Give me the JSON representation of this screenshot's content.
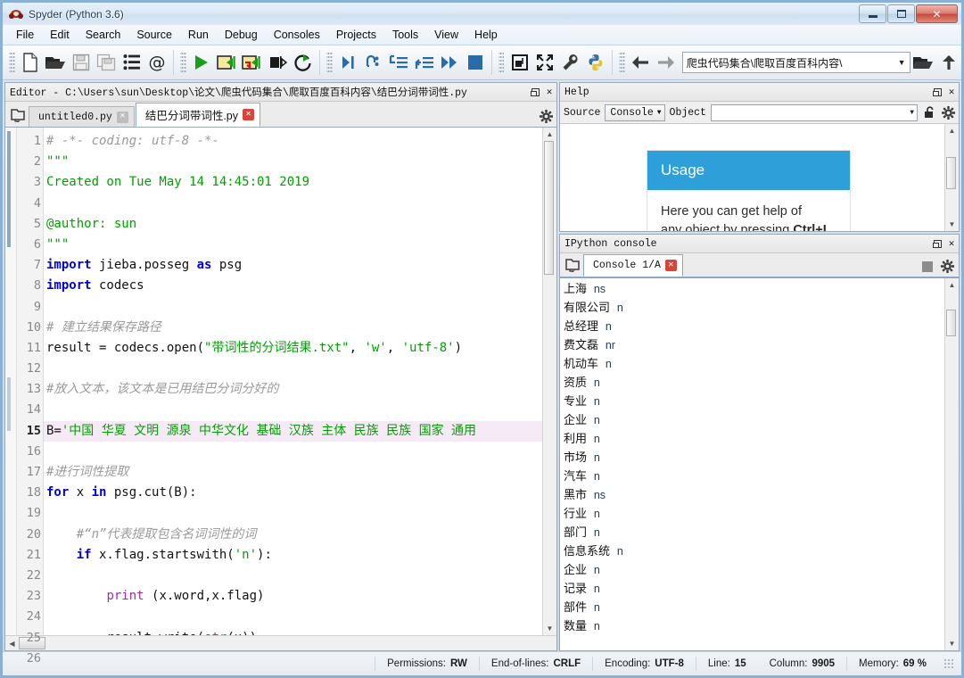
{
  "window": {
    "title": "Spyder (Python 3.6)",
    "app_icon": "spyder-icon",
    "minimize_label": "Minimize",
    "maximize_label": "Maximize",
    "close_label": "✕"
  },
  "menubar": {
    "items": [
      {
        "label": "File",
        "accel": "F"
      },
      {
        "label": "Edit",
        "accel": "E"
      },
      {
        "label": "Search",
        "accel": "S"
      },
      {
        "label": "Source",
        "accel": "c"
      },
      {
        "label": "Run",
        "accel": "R"
      },
      {
        "label": "Debug",
        "accel": "D"
      },
      {
        "label": "Consoles",
        "accel": "o"
      },
      {
        "label": "Projects",
        "accel": "P"
      },
      {
        "label": "Tools",
        "accel": "T"
      },
      {
        "label": "View",
        "accel": "V"
      },
      {
        "label": "Help",
        "accel": "H"
      }
    ]
  },
  "toolbar": {
    "buttons": [
      {
        "name": "new-file-icon",
        "tooltip": "New file"
      },
      {
        "name": "open-file-icon",
        "tooltip": "Open file"
      },
      {
        "name": "save-file-icon",
        "tooltip": "Save file"
      },
      {
        "name": "save-all-icon",
        "tooltip": "Save all"
      },
      {
        "name": "file-switcher-icon",
        "tooltip": "File switcher"
      },
      {
        "name": "find-symbol-icon",
        "tooltip": "Symbol finder"
      },
      {
        "name": "run-file-icon",
        "tooltip": "Run file"
      },
      {
        "name": "run-cell-icon",
        "tooltip": "Run current cell"
      },
      {
        "name": "run-cell-advance-icon",
        "tooltip": "Run cell and advance"
      },
      {
        "name": "run-selection-icon",
        "tooltip": "Run selection"
      },
      {
        "name": "rerun-file-icon",
        "tooltip": "Re-run last script"
      },
      {
        "name": "debug-file-icon",
        "tooltip": "Debug file"
      },
      {
        "name": "step-over-icon",
        "tooltip": "Run current line"
      },
      {
        "name": "step-into-icon",
        "tooltip": "Step into"
      },
      {
        "name": "step-return-icon",
        "tooltip": "Step return"
      },
      {
        "name": "continue-icon",
        "tooltip": "Continue execution"
      },
      {
        "name": "stop-debug-icon",
        "tooltip": "Stop debugging"
      },
      {
        "name": "maximize-pane-icon",
        "tooltip": "Maximize current pane"
      },
      {
        "name": "fullscreen-icon",
        "tooltip": "Fullscreen mode"
      },
      {
        "name": "preferences-icon",
        "tooltip": "Preferences"
      },
      {
        "name": "python-path-icon",
        "tooltip": "PYTHONPATH manager"
      },
      {
        "name": "back-icon",
        "tooltip": "Back"
      },
      {
        "name": "forward-icon",
        "tooltip": "Forward"
      },
      {
        "name": "browse-dir-icon",
        "tooltip": "Browse a working directory"
      },
      {
        "name": "parent-dir-icon",
        "tooltip": "Change to parent directory"
      }
    ],
    "path_value": "\\爬虫代码集合\\爬取百度百科内容"
  },
  "editor": {
    "pane_title": "Editor - C:\\Users\\sun\\Desktop\\论文\\爬虫代码集合\\爬取百度百科内容\\结巴分词带词性.py",
    "tabs": [
      {
        "label": "untitled0.py",
        "active": false
      },
      {
        "label": "结巴分词带词性.py",
        "active": true
      }
    ],
    "current_line": 15,
    "lines": [
      {
        "n": 1,
        "tokens": [
          {
            "t": "# -*- coding: utf-8 -*-",
            "c": "cm"
          }
        ]
      },
      {
        "n": 2,
        "tokens": [
          {
            "t": "\"\"\"",
            "c": "cs"
          }
        ]
      },
      {
        "n": 3,
        "tokens": [
          {
            "t": "Created on Tue May 14 14:45:01 2019",
            "c": "cs"
          }
        ]
      },
      {
        "n": 4,
        "tokens": []
      },
      {
        "n": 5,
        "tokens": [
          {
            "t": "@author: sun",
            "c": "cs"
          }
        ]
      },
      {
        "n": 6,
        "tokens": [
          {
            "t": "\"\"\"",
            "c": "cs"
          }
        ]
      },
      {
        "n": 7,
        "tokens": [
          {
            "t": "import",
            "c": "ck"
          },
          {
            "t": " jieba.posseg ",
            "c": "cn"
          },
          {
            "t": "as",
            "c": "ck"
          },
          {
            "t": " psg",
            "c": "cn"
          }
        ]
      },
      {
        "n": 8,
        "tokens": [
          {
            "t": "import",
            "c": "ck"
          },
          {
            "t": " codecs",
            "c": "cn"
          }
        ]
      },
      {
        "n": 9,
        "tokens": []
      },
      {
        "n": 10,
        "tokens": [
          {
            "t": "# 建立结果保存路径",
            "c": "cm"
          }
        ]
      },
      {
        "n": 11,
        "tokens": [
          {
            "t": "result = codecs.open(",
            "c": "cn"
          },
          {
            "t": "\"带词性的分词结果.txt\"",
            "c": "cs"
          },
          {
            "t": ", ",
            "c": "cn"
          },
          {
            "t": "'w'",
            "c": "cs"
          },
          {
            "t": ", ",
            "c": "cn"
          },
          {
            "t": "'utf-8'",
            "c": "cs"
          },
          {
            "t": ")",
            "c": "cn"
          }
        ]
      },
      {
        "n": 12,
        "tokens": []
      },
      {
        "n": 13,
        "tokens": [
          {
            "t": "#放入文本，该文本是已用结巴分词分好的",
            "c": "cm"
          }
        ]
      },
      {
        "n": 14,
        "tokens": []
      },
      {
        "n": 15,
        "tokens": [
          {
            "t": "B=",
            "c": "cn"
          },
          {
            "t": "'中国 华夏 文明 源泉 中华文化 基础 汉族 主体 民族 民族 国家 通用",
            "c": "cs"
          }
        ],
        "current": true
      },
      {
        "n": 16,
        "tokens": []
      },
      {
        "n": 17,
        "tokens": [
          {
            "t": "#进行词性提取",
            "c": "cm"
          }
        ]
      },
      {
        "n": 18,
        "tokens": [
          {
            "t": "for",
            "c": "ck"
          },
          {
            "t": " x ",
            "c": "cn"
          },
          {
            "t": "in",
            "c": "ck"
          },
          {
            "t": " psg.cut(B):",
            "c": "cn"
          }
        ]
      },
      {
        "n": 19,
        "tokens": []
      },
      {
        "n": 20,
        "tokens": [
          {
            "t": "    #“n”代表提取包含名词词性的词",
            "c": "cm"
          }
        ]
      },
      {
        "n": 21,
        "tokens": [
          {
            "t": "    ",
            "c": "cn"
          },
          {
            "t": "if",
            "c": "ck"
          },
          {
            "t": " x.flag.startswith(",
            "c": "cn"
          },
          {
            "t": "'n'",
            "c": "cs"
          },
          {
            "t": "):",
            "c": "cn"
          }
        ]
      },
      {
        "n": 22,
        "tokens": []
      },
      {
        "n": 23,
        "tokens": [
          {
            "t": "        ",
            "c": "cn"
          },
          {
            "t": "print",
            "c": "cb"
          },
          {
            "t": " (x.word,x.flag)",
            "c": "cn"
          }
        ]
      },
      {
        "n": 24,
        "tokens": []
      },
      {
        "n": 25,
        "tokens": [
          {
            "t": "        result.write(",
            "c": "cn"
          },
          {
            "t": "str",
            "c": "cb"
          },
          {
            "t": "(x))",
            "c": "cn"
          }
        ]
      },
      {
        "n": 26,
        "tokens": []
      }
    ]
  },
  "help": {
    "pane_title": "Help",
    "source_label": "Source",
    "source_value": "Console",
    "object_label": "Object",
    "object_value": "",
    "lock_icon": "unlock-icon",
    "options_icon": "gear-icon",
    "card_title": "Usage",
    "card_text_1": "Here you can get help of",
    "card_text_2_pre": "any object by pressing ",
    "card_text_2_bold": "Ctrl+I",
    "card_accent": "#2e9fd8"
  },
  "console": {
    "pane_title": "IPython console",
    "tab_label": "Console 1/A",
    "browse_icon": "browse-tabs-icon",
    "stop_icon": "stop-icon",
    "options_icon": "gear-icon",
    "output": [
      {
        "word": "上海",
        "flag": "ns"
      },
      {
        "word": "有限公司",
        "flag": "n"
      },
      {
        "word": "总经理",
        "flag": "n"
      },
      {
        "word": "费文磊",
        "flag": "nr"
      },
      {
        "word": "机动车",
        "flag": "n"
      },
      {
        "word": "资质",
        "flag": "n"
      },
      {
        "word": "专业",
        "flag": "n"
      },
      {
        "word": "企业",
        "flag": "n"
      },
      {
        "word": "利用",
        "flag": "n"
      },
      {
        "word": "市场",
        "flag": "n"
      },
      {
        "word": "汽车",
        "flag": "n"
      },
      {
        "word": "黑市",
        "flag": "ns"
      },
      {
        "word": "行业",
        "flag": "n"
      },
      {
        "word": "部门",
        "flag": "n"
      },
      {
        "word": "信息系统",
        "flag": "n"
      },
      {
        "word": "企业",
        "flag": "n"
      },
      {
        "word": "记录",
        "flag": "n"
      },
      {
        "word": "部件",
        "flag": "n"
      },
      {
        "word": "数量",
        "flag": "n"
      }
    ]
  },
  "statusbar": {
    "items": [
      {
        "label": "Permissions:",
        "value": "RW"
      },
      {
        "label": "End-of-lines:",
        "value": "CRLF"
      },
      {
        "label": "Encoding:",
        "value": "UTF-8"
      },
      {
        "label": "Line:",
        "value": "15"
      },
      {
        "label": "Column:",
        "value": "9905"
      },
      {
        "label": "Memory:",
        "value": "69 %"
      }
    ]
  }
}
